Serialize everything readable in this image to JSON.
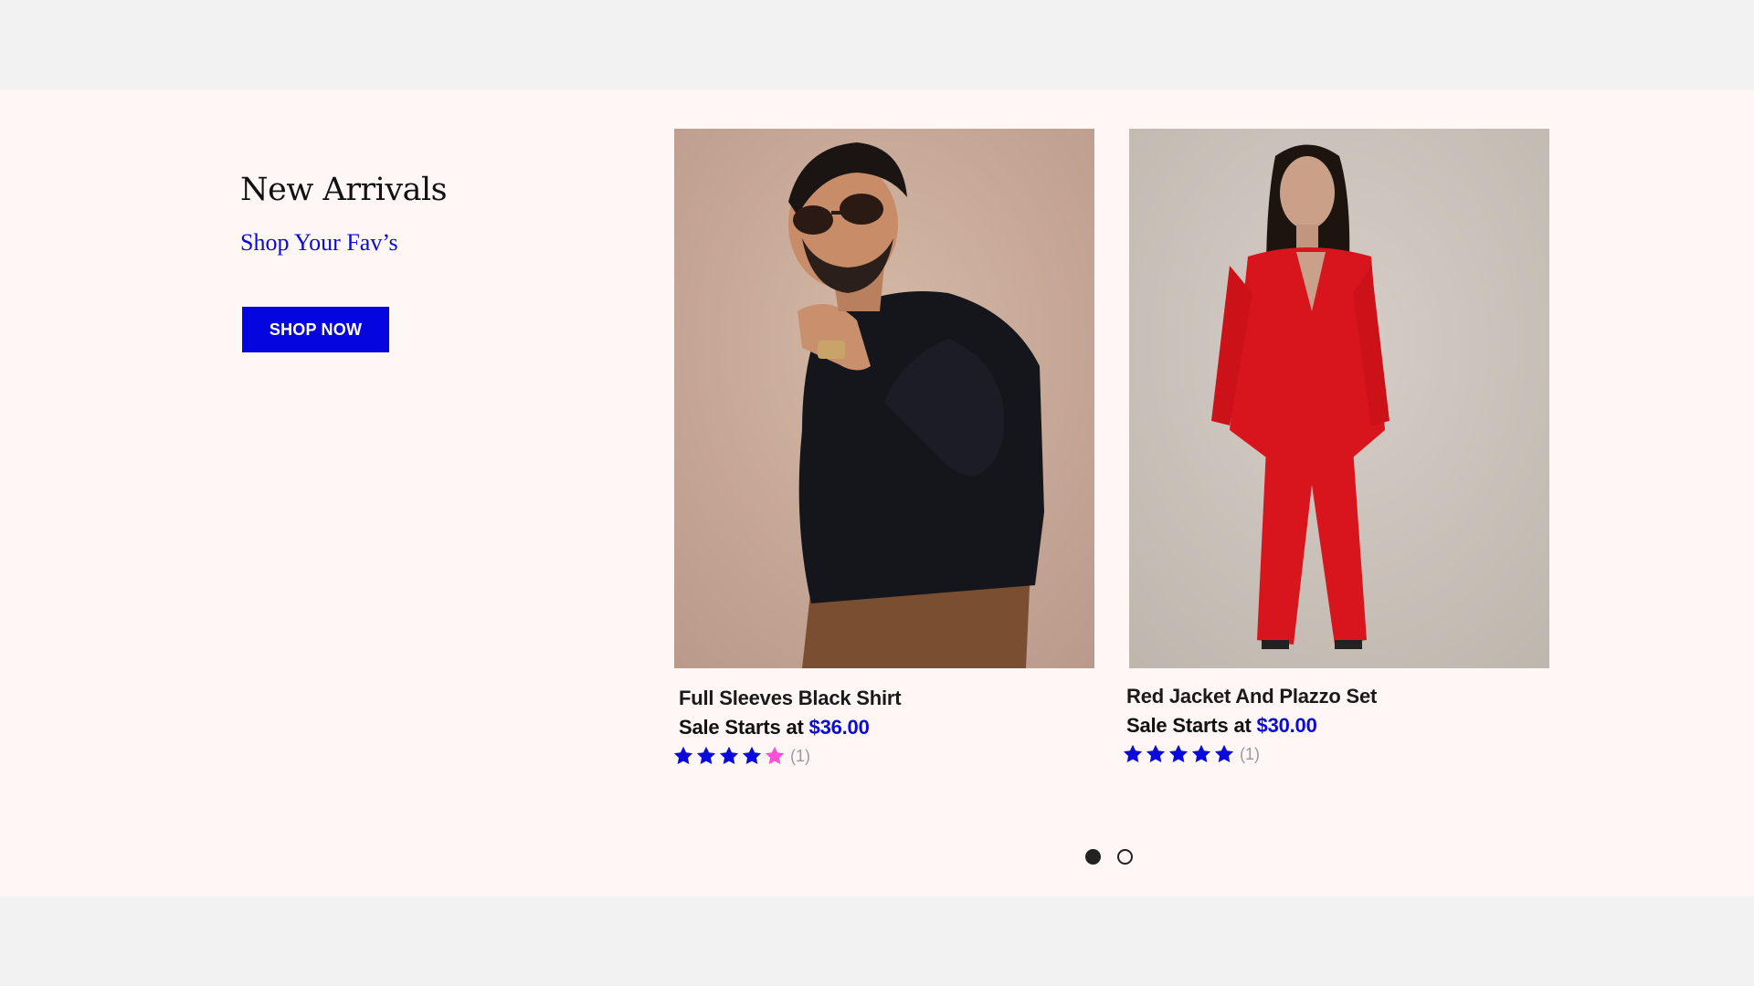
{
  "section": {
    "title": "New Arrivals",
    "subtitle": "Shop Your Fav’s",
    "cta_label": "SHOP NOW"
  },
  "products": [
    {
      "name": "Full Sleeves Black Shirt",
      "sale_prefix": "Sale Starts at",
      "price": "$36.00",
      "rating": 4,
      "rating_max": 5,
      "reviews": "(1)",
      "image_desc_icon": "man-black-shirt-photo"
    },
    {
      "name": "Red Jacket And Plazzo Set",
      "sale_prefix": "Sale Starts at",
      "price": "$30.00",
      "rating": 5,
      "rating_max": 5,
      "reviews": "(1)",
      "image_desc_icon": "woman-red-suit-photo"
    }
  ],
  "carousel": {
    "pages": 2,
    "active": 0
  },
  "colors": {
    "accent": "#0505e0",
    "star_filled": "#0a0adb",
    "star_empty": "#ff4fd8",
    "band": "#fff7f5"
  }
}
